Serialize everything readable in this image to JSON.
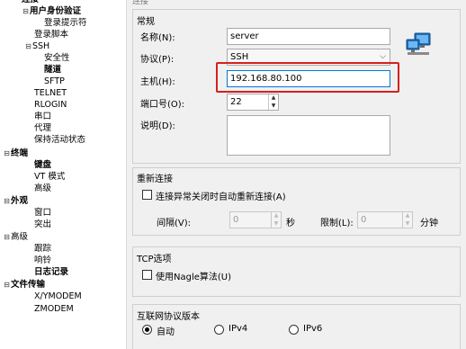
{
  "tree": [
    {
      "label": "连接",
      "exp": "",
      "bold": true
    },
    {
      "label": "用户身份验证",
      "exp": "⊟",
      "bold": true
    },
    {
      "label": "登录提示符",
      "exp": "",
      "bold": false
    },
    {
      "label": "登录脚本",
      "exp": "",
      "bold": false
    },
    {
      "label": "SSH",
      "exp": "⊟",
      "bold": false
    },
    {
      "label": "安全性",
      "exp": "",
      "bold": false
    },
    {
      "label": "隧道",
      "exp": "",
      "bold": true
    },
    {
      "label": "SFTP",
      "exp": "",
      "bold": false
    },
    {
      "label": "TELNET",
      "exp": "",
      "bold": false
    },
    {
      "label": "RLOGIN",
      "exp": "",
      "bold": false
    },
    {
      "label": "串口",
      "exp": "",
      "bold": false
    },
    {
      "label": "代理",
      "exp": "",
      "bold": false
    },
    {
      "label": "保持活动状态",
      "exp": "",
      "bold": false
    },
    {
      "label": "终端",
      "exp": "⊟",
      "bold": true
    },
    {
      "label": "键盘",
      "exp": "",
      "bold": true
    },
    {
      "label": "VT 模式",
      "exp": "",
      "bold": false
    },
    {
      "label": "高级",
      "exp": "",
      "bold": false
    },
    {
      "label": "外观",
      "exp": "⊟",
      "bold": true
    },
    {
      "label": "窗口",
      "exp": "",
      "bold": false
    },
    {
      "label": "突出",
      "exp": "",
      "bold": false
    },
    {
      "label": "高级",
      "exp": "⊟",
      "bold": false
    },
    {
      "label": "跟踪",
      "exp": "",
      "bold": false
    },
    {
      "label": "响铃",
      "exp": "",
      "bold": false
    },
    {
      "label": "日志记录",
      "exp": "",
      "bold": true
    },
    {
      "label": "文件传输",
      "exp": "⊟",
      "bold": true
    },
    {
      "label": "X/YMODEM",
      "exp": "",
      "bold": false
    },
    {
      "label": "ZMODEM",
      "exp": "",
      "bold": false
    }
  ],
  "header": {
    "partial": "连接"
  },
  "general": {
    "title": "常规",
    "name_label": "名称(N):",
    "name_value": "server",
    "protocol_label": "协议(P):",
    "protocol_value": "SSH",
    "host_label": "主机(H):",
    "host_value": "192.168.80.100",
    "port_label": "端口号(O):",
    "port_value": "22",
    "desc_label": "说明(D):",
    "desc_value": ""
  },
  "reconnect": {
    "title": "重新连接",
    "checkbox_label": "连接异常关闭时自动重新连接(A)",
    "interval_label": "间隔(V):",
    "interval_value": "0",
    "interval_unit": "秒",
    "limit_label": "限制(L):",
    "limit_value": "0",
    "limit_unit": "分钟"
  },
  "tcp": {
    "title": "TCP选项",
    "nagle_label": "使用Nagle算法(U)"
  },
  "ipver": {
    "title": "互联网协议版本",
    "auto": "自动",
    "ipv4": "IPv4",
    "ipv6": "IPv6"
  },
  "spin": {
    "up": "▲",
    "down": "▼"
  },
  "select_chev": "⌵",
  "colors": {
    "highlight": "#d3211f",
    "monitor": "#1e73be"
  }
}
